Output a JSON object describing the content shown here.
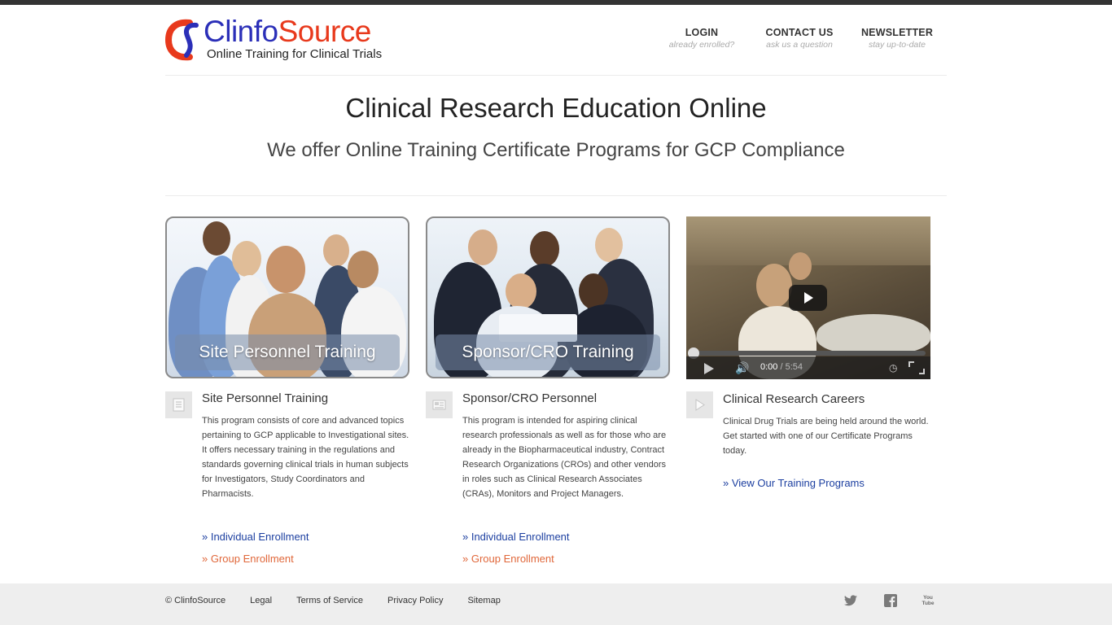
{
  "brand": {
    "name_part1": "Clinfo",
    "name_part2": "Source",
    "tagline": "Online Training for Clinical Trials",
    "colors": {
      "blue": "#2b2fb8",
      "red": "#e8391c"
    }
  },
  "nav": [
    {
      "title": "LOGIN",
      "sub": "already enrolled?"
    },
    {
      "title": "CONTACT US",
      "sub": "ask us a question"
    },
    {
      "title": "NEWSLETTER",
      "sub": "stay up-to-date"
    }
  ],
  "hero": {
    "title": "Clinical Research Education Online",
    "subtitle": "We offer Online Training Certificate Programs for GCP Compliance"
  },
  "images": {
    "site_caption": "Site Personnel Training",
    "sponsor_caption": "Sponsor/CRO Training"
  },
  "video": {
    "current_time": "0:00",
    "separator": " / ",
    "duration": "5:54",
    "progress": 0.0
  },
  "columns": [
    {
      "icon": "document-icon",
      "title": "Site Personnel Training",
      "text": "This program consists of core and advanced topics pertaining to GCP applicable to Investigational sites. It offers necessary training in the regulations and standards governing clinical trials in human subjects for Investigators, Study Coordinators and Pharmacists.",
      "link_individual": "» Individual Enrollment",
      "link_group": "» Group Enrollment"
    },
    {
      "icon": "newspaper-icon",
      "title": "Sponsor/CRO Personnel",
      "text": "This program is intended for aspiring clinical research professionals as well as for those who are already in the Biopharmaceutical industry, Contract Research Organizations (CROs) and other vendors in roles such as Clinical Research Associates (CRAs), Monitors and Project Managers.",
      "link_individual": "» Individual Enrollment",
      "link_group": "» Group Enrollment"
    },
    {
      "icon": "play-icon",
      "title": "Clinical Research Careers",
      "text": "Clinical Drug Trials are being held around the world. Get started with one of our Certificate Programs today.",
      "link": "» View Our Training Programs"
    }
  ],
  "footer": {
    "copyright": "© ClinfoSource",
    "links": [
      "Legal",
      "Terms of Service",
      "Privacy Policy",
      "Sitemap"
    ],
    "social": [
      "twitter-icon",
      "facebook-icon",
      "youtube-icon"
    ],
    "youtube_text": "You Tube"
  }
}
